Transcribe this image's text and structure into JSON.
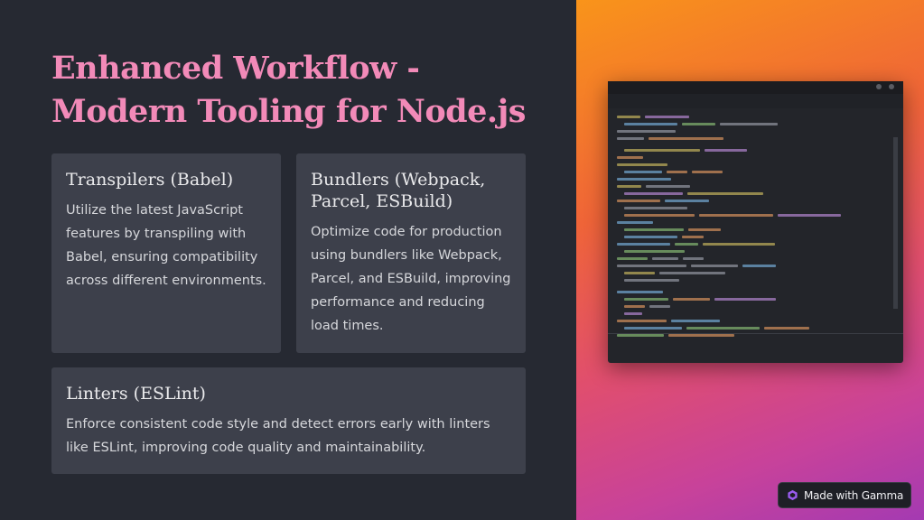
{
  "slide": {
    "title": "Enhanced Workflow - Modern Tooling for Node.js",
    "cards": [
      {
        "heading": "Transpilers (Babel)",
        "body": "Utilize the latest JavaScript features by transpiling with Babel, ensuring compatibility across different environments."
      },
      {
        "heading": "Bundlers (Webpack, Parcel, ESBuild)",
        "body": "Optimize code for production using bundlers like Webpack, Parcel, and ESBuild, improving performance and reducing load times."
      },
      {
        "heading": "Linters (ESLint)",
        "body": "Enforce consistent code style and detect errors early with linters like ESLint, improving code quality and maintainability."
      }
    ]
  },
  "illustration": {
    "icon": "code-editor-screenshot-image",
    "gradient_colors": [
      "#f9941a",
      "#e04e6e",
      "#a43ab2"
    ]
  },
  "badge": {
    "label": "Made with Gamma",
    "icon": "gamma-logo-icon"
  },
  "colors": {
    "background": "#262932",
    "title": "#f28ab8",
    "card": "#3d404b"
  }
}
